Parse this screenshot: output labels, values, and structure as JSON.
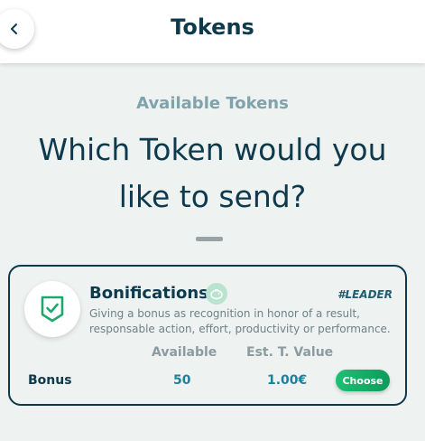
{
  "header": {
    "title": "Tokens",
    "back_icon": "chevron-left-icon"
  },
  "main": {
    "subtitle": "Available Tokens",
    "question": "Which Token would you like to send?"
  },
  "token_card": {
    "title": "Bonifications",
    "tag": "#LEADER",
    "description": "Giving a bonus as recognition in honor of a result, responsable action, effort, productivity or performance.",
    "icon": "shield-check-icon",
    "badge_icon": "piggy-bank-icon",
    "columns": {
      "available": "Available",
      "est_value": "Est. T. Value"
    },
    "row": {
      "name": "Bonus",
      "available": "50",
      "est_value": "1.00€"
    },
    "choose_label": "Choose"
  },
  "colors": {
    "primary": "#0e3a4e",
    "accent": "#1fa86e",
    "muted": "#7fa3ad",
    "value": "#1e7f9e"
  }
}
